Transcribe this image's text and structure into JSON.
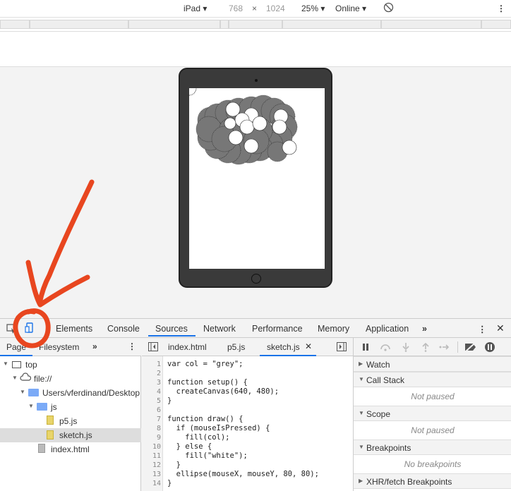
{
  "device_bar": {
    "device": "iPad",
    "width": "768",
    "times": "×",
    "height": "1024",
    "zoom": "25%",
    "network": "Online",
    "more": "⋮"
  },
  "devtools": {
    "tabs": [
      "Elements",
      "Console",
      "Sources",
      "Network",
      "Performance",
      "Memory",
      "Application"
    ],
    "more_tabs": "»",
    "left_tabs": [
      "Page",
      "Filesystem"
    ],
    "left_more": "»"
  },
  "tree": {
    "top": "top",
    "file": "file://",
    "folder": "Users/vferdinand/Desktop",
    "js": "js",
    "p5": "p5.js",
    "sketch": "sketch.js",
    "index": "index.html"
  },
  "editor_tabs": [
    "index.html",
    "p5.js",
    "sketch.js"
  ],
  "code_lines": [
    "var col = \"grey\";",
    "",
    "function setup() {",
    "  createCanvas(640, 480);",
    "}",
    "",
    "function draw() {",
    "  if (mouseIsPressed) {",
    "    fill(col);",
    "  } else {",
    "    fill(\"white\");",
    "  }",
    "  ellipse(mouseX, mouseY, 80, 80);",
    "}"
  ],
  "line_numbers": [
    "1",
    "2",
    "3",
    "4",
    "5",
    "6",
    "7",
    "8",
    "9",
    "10",
    "11",
    "12",
    "13",
    "14"
  ],
  "debugger": {
    "watch": "Watch",
    "call_stack": "Call Stack",
    "call_stack_note": "Not paused",
    "scope": "Scope",
    "scope_note": "Not paused",
    "breakpoints": "Breakpoints",
    "breakpoints_note": "No breakpoints",
    "xhr": "XHR/fetch Breakpoints"
  },
  "colors": {
    "accent": "#1a73e8",
    "annotation": "#e8461f"
  }
}
